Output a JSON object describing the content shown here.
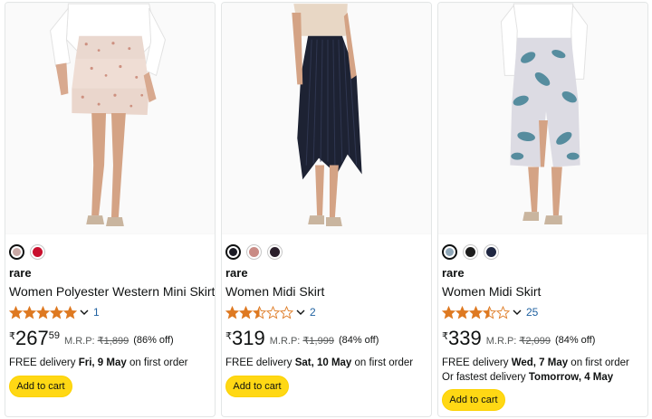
{
  "products": [
    {
      "swatches": [
        {
          "color": "#c9a9a6",
          "selected": true
        },
        {
          "color": "#c8102e",
          "selected": false
        }
      ],
      "brand": "rare",
      "title": "Women Polyester Western Mini Skirt",
      "rating": 5,
      "rating_count": "1",
      "currency": "₹",
      "price_whole": "267",
      "price_fraction": "59",
      "mrp_label": "M.R.P:",
      "mrp": "₹1,899",
      "discount": "(86% off)",
      "delivery_prefix": "FREE delivery ",
      "delivery_date": "Fri, 9 May",
      "delivery_suffix": " on first order",
      "fastest_prefix": "",
      "fastest_date": "",
      "add_to_cart": "Add to cart",
      "image_icon": "skirt-print-photo"
    },
    {
      "swatches": [
        {
          "color": "#1b1b24",
          "selected": true
        },
        {
          "color": "#c98b85",
          "selected": false
        },
        {
          "color": "#2a1f2b",
          "selected": false
        }
      ],
      "brand": "rare",
      "title": "Women Midi Skirt",
      "rating": 2.5,
      "rating_count": "2",
      "currency": "₹",
      "price_whole": "319",
      "price_fraction": "",
      "mrp_label": "M.R.P:",
      "mrp": "₹1,999",
      "discount": "(84% off)",
      "delivery_prefix": "FREE delivery ",
      "delivery_date": "Sat, 10 May",
      "delivery_suffix": " on first order",
      "fastest_prefix": "",
      "fastest_date": "",
      "add_to_cart": "Add to cart",
      "image_icon": "skirt-pleated-photo"
    },
    {
      "swatches": [
        {
          "color": "#8fa7b8",
          "selected": true
        },
        {
          "color": "#1c1c1c",
          "selected": false
        },
        {
          "color": "#1f2742",
          "selected": false
        }
      ],
      "brand": "rare",
      "title": "Women Midi Skirt",
      "rating": 3.5,
      "rating_count": "25",
      "currency": "₹",
      "price_whole": "339",
      "price_fraction": "",
      "mrp_label": "M.R.P:",
      "mrp": "₹2,099",
      "discount": "(84% off)",
      "delivery_prefix": "FREE delivery ",
      "delivery_date": "Wed, 7 May",
      "delivery_suffix": " on first order",
      "fastest_prefix": "Or fastest delivery ",
      "fastest_date": "Tomorrow, 4 May",
      "add_to_cart": "Add to cart",
      "image_icon": "skirt-floral-photo"
    }
  ],
  "colors": {
    "star": "#de7921",
    "link": "#2162a1",
    "button": "#ffd814"
  }
}
